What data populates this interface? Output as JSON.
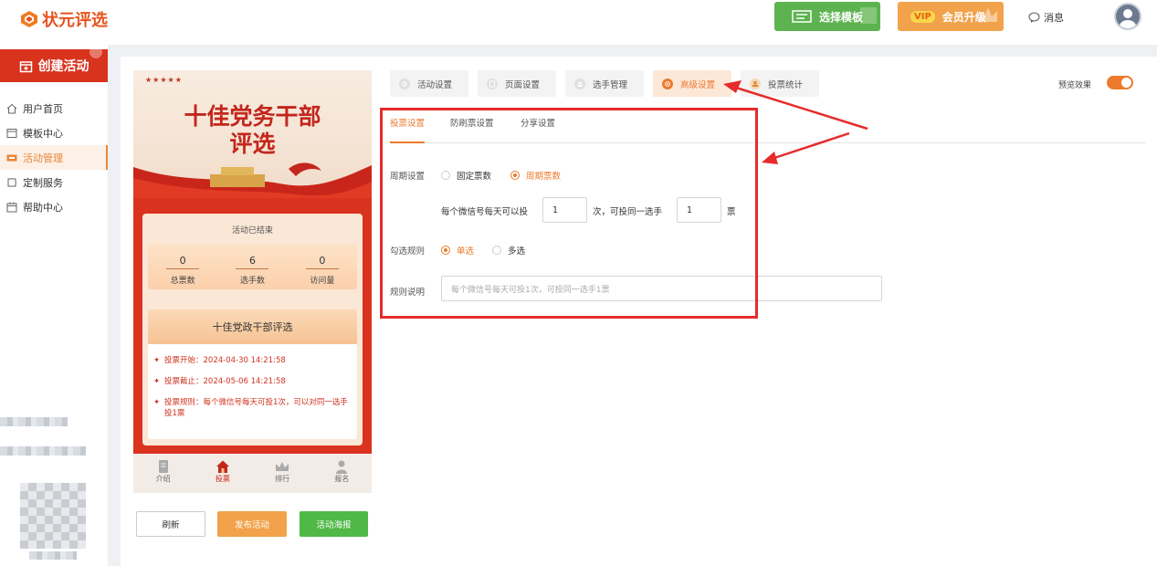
{
  "header": {
    "logo_text": "状元评选",
    "template_button": "选择模板",
    "vip_badge": "VIP",
    "vip_button": "会员升级",
    "messages_label": "消息"
  },
  "sidebar": {
    "create_button": "创建活动",
    "items": [
      {
        "label": "用户首页",
        "icon": "home-icon",
        "active": false
      },
      {
        "label": "模板中心",
        "icon": "window-icon",
        "active": false
      },
      {
        "label": "活动管理",
        "icon": "ticket-icon",
        "active": true
      },
      {
        "label": "定制服务",
        "icon": "puzzle-icon",
        "active": false
      },
      {
        "label": "帮助中心",
        "icon": "calendar-icon",
        "active": false
      }
    ]
  },
  "preview": {
    "stars": "★★★★★",
    "banner_title_line1": "十佳党务干部",
    "banner_title_line2": "评选",
    "status": "活动已结束",
    "stats": [
      {
        "value": "0",
        "label": "总票数"
      },
      {
        "value": "6",
        "label": "选手数"
      },
      {
        "value": "0",
        "label": "访问量"
      }
    ],
    "activity_title": "十佳党政干部评选",
    "lines": [
      "投票开始：2024-04-30 14:21:58",
      "投票截止：2024-05-06 14:21:58",
      "投票规则：每个微信号每天可投1次，可以对同一选手投1票"
    ],
    "nav": [
      {
        "label": "介绍",
        "icon": "document-icon",
        "active": false
      },
      {
        "label": "投票",
        "icon": "house-icon",
        "active": true
      },
      {
        "label": "排行",
        "icon": "crown-icon",
        "active": false
      },
      {
        "label": "报名",
        "icon": "person-icon",
        "active": false
      }
    ],
    "buttons": {
      "refresh": "刷新",
      "publish": "发布活动",
      "poster": "活动海报"
    }
  },
  "settings": {
    "tabs": [
      "活动设置",
      "页面设置",
      "选手管理",
      "高级设置",
      "投票统计"
    ],
    "active_tab": "高级设置",
    "preview_label": "预览效果",
    "preview_toggle_on": true,
    "subtabs": [
      "投票设置",
      "防刷票设置",
      "分享设置"
    ],
    "active_subtab": "投票设置",
    "period": {
      "label": "周期设置",
      "options": [
        "固定票数",
        "周期票数"
      ],
      "selected": "周期票数",
      "text_before": "每个微信号每天可以投",
      "times_value": "1",
      "text_middle": "次，可投同一选手",
      "votes_value": "1",
      "text_after": "票"
    },
    "selection": {
      "label": "勾选规则",
      "options": [
        "单选",
        "多选"
      ],
      "selected": "单选"
    },
    "rule": {
      "label": "规则说明",
      "placeholder": "每个微信号每天可投1次，可投同一选手1票"
    }
  },
  "annotation": {
    "color": "#e62b2b"
  }
}
